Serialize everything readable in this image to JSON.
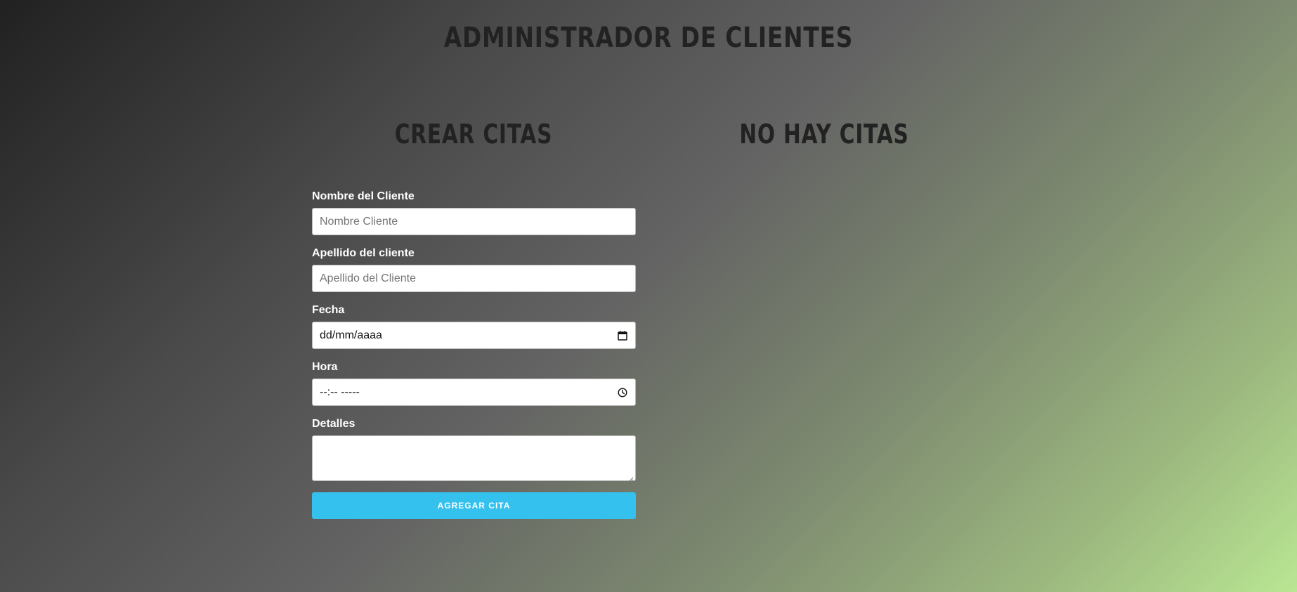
{
  "header": {
    "title": "Administrador de Clientes"
  },
  "form_section": {
    "title": "Crear Citas",
    "fields": [
      {
        "label": "Nombre del Cliente",
        "placeholder": "Nombre Cliente"
      },
      {
        "label": "Apellido del cliente",
        "placeholder": "Apellido del Cliente"
      },
      {
        "label": "Fecha",
        "value": "dd/mm/aaaa",
        "icon": "calendar-icon"
      },
      {
        "label": "Hora",
        "value": "--:-- -----",
        "icon": "clock-icon"
      },
      {
        "label": "Detalles",
        "value": ""
      }
    ],
    "submit_label": "Agregar Cita"
  },
  "list_section": {
    "title": "No hay citas"
  },
  "colors": {
    "accent": "#35c1ee",
    "heading": "#222222",
    "gradient_start": "#212121",
    "gradient_end": "#b9e693"
  }
}
